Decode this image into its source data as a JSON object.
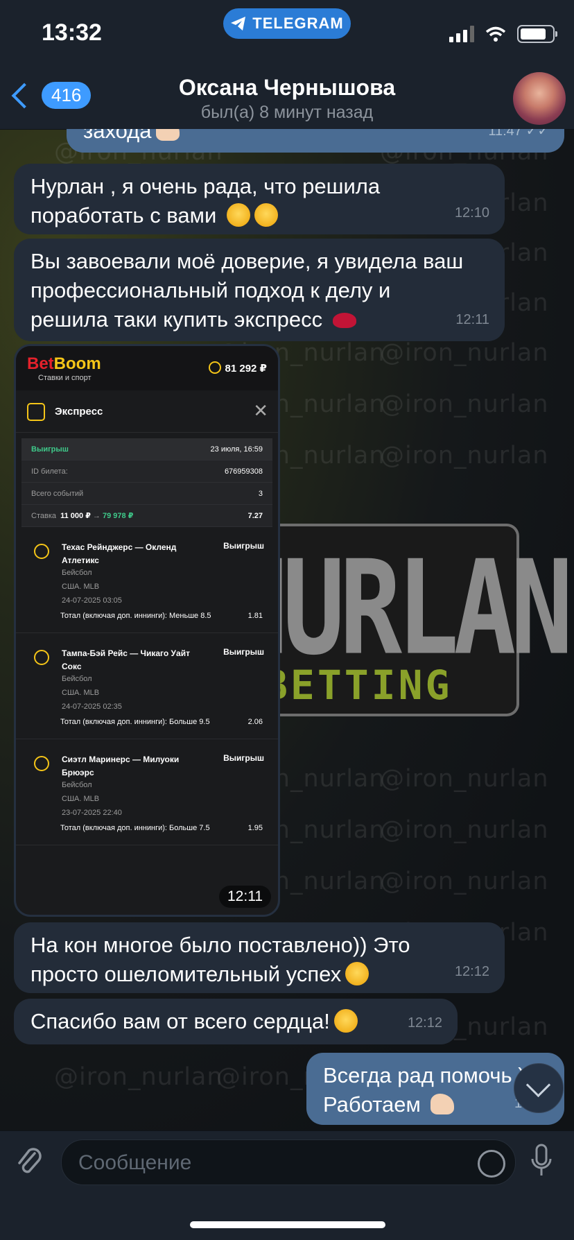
{
  "status": {
    "time": "13:32",
    "pill": "TELEGRAM"
  },
  "header": {
    "back_count": "416",
    "title": "Оксана Чернышова",
    "subtitle": "был(а) 8 минут назад"
  },
  "watermark": {
    "handle": "@iron_nurlan",
    "logo_big": "NURLAN",
    "logo_small": "BETTING"
  },
  "messages": [
    {
      "text": "захода",
      "time": "11:47",
      "direction": "out"
    },
    {
      "text_line1": "Нурлан , я очень рада, что решила",
      "text_line2": "поработать с вами",
      "time": "12:10",
      "direction": "in"
    },
    {
      "text_line1": "Вы завоевали моё доверие, я увидела ваш",
      "text_line2": "профессиональный подход к делу и",
      "text_line3": "решила таки купить экспресс",
      "time": "12:11",
      "direction": "in"
    },
    {
      "text_line1": "На кон многое было поставлено)) Это",
      "text_line2": "просто ошеломительный успех",
      "time": "12:12",
      "direction": "in"
    },
    {
      "text": "Спасибо вам от всего сердца!",
      "time": "12:12",
      "direction": "in"
    },
    {
      "text_line1": "Всегда рад помочь ))",
      "text_line2": "Работаем",
      "time": "12:13",
      "direction": "out"
    }
  ],
  "betslip": {
    "brand_a": "Bet",
    "brand_b": "Boom",
    "brand_sub": "Ставки и спорт",
    "balance": "81 292 ₽",
    "title": "Экспресс",
    "status_label": "Выигрыш",
    "date": "23 июля, 16:59",
    "ticket_label": "ID билета:",
    "ticket_id": "676959308",
    "events_label": "Всего событий",
    "events_count": "3",
    "stake_label": "Ставка",
    "stake": "11 000 ₽",
    "payout": "79 978 ₽",
    "total_odds": "7.27",
    "events": [
      {
        "name": "Техас Рейнджерс — Окленд Атлетикс",
        "result": "Выигрыш",
        "sport": "Бейсбол",
        "league": "США. MLB",
        "datetime": "24-07-2025 03:05",
        "market": "Тотал (включая доп. иннинги): Меньше 8.5",
        "odds": "1.81"
      },
      {
        "name": "Тампа-Бэй Рейс — Чикаго Уайт Сокс",
        "result": "Выигрыш",
        "sport": "Бейсбол",
        "league": "США. MLB",
        "datetime": "24-07-2025 02:35",
        "market": "Тотал (включая доп. иннинги): Больше 9.5",
        "odds": "2.06"
      },
      {
        "name": "Сиэтл Маринерс — Милуоки Брюэрс",
        "result": "Выигрыш",
        "sport": "Бейсбол",
        "league": "США. MLB",
        "datetime": "23-07-2025 22:40",
        "market": "Тотал (включая доп. иннинги): Больше 7.5",
        "odds": "1.95"
      }
    ],
    "time": "12:11"
  },
  "composer": {
    "placeholder": "Сообщение"
  },
  "icons": {
    "back": "chevron-left-icon",
    "clip": "paperclip-icon",
    "sticker": "sticker-icon",
    "mic": "microphone-icon",
    "scroll": "chevron-down-icon"
  }
}
